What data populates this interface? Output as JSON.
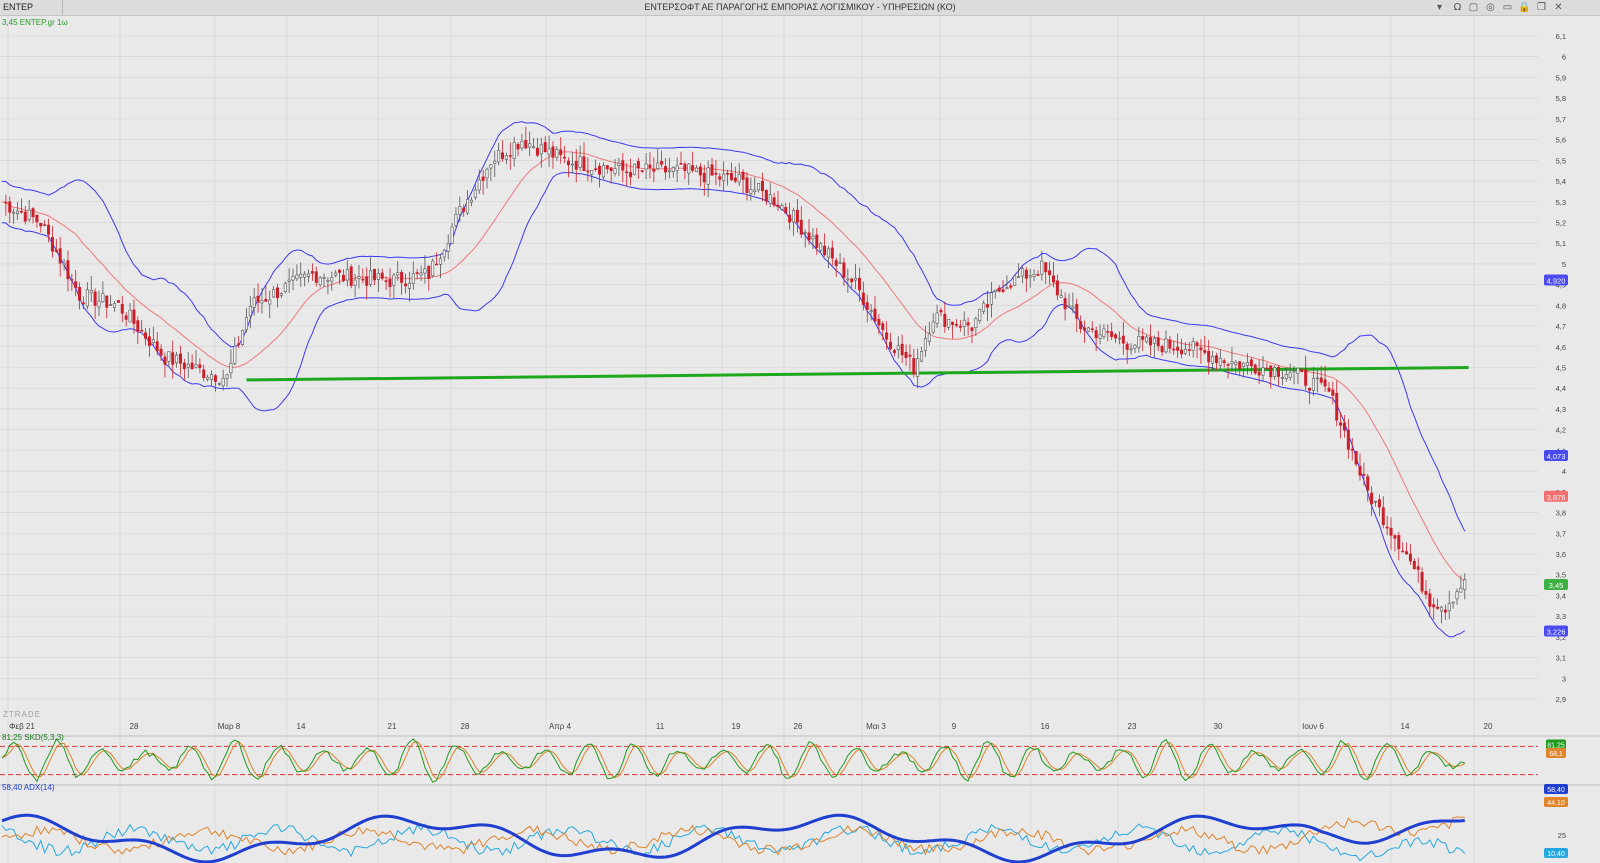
{
  "window": {
    "symbol_tab": "ENTEP",
    "title": "ΕΝΤΕΡΣΟΦΤ ΑΕ ΠΑΡΑΓΩΓΗΣ ΕΜΠΟΡΙΑΣ ΛΟΓΙΣΜΙΚΟΥ - ΥΠΗΡΕΣΙΩΝ  (ΚΟ)",
    "icons": [
      "dropdown-icon",
      "omega-icon",
      "window-icon",
      "layout-icon",
      "minimize-icon",
      "lock-icon",
      "restore-icon",
      "close-icon"
    ]
  },
  "colors": {
    "up_candle": "#555555",
    "down_candle": "#cc1f2a",
    "bollinger": "#3a3af0",
    "ma": "#f07878",
    "support": "#1ea81e",
    "stoch_k": "#1f9a1f",
    "stoch_d": "#e0832a",
    "adx": "#1f3fd0",
    "di_plus": "#26a9e0",
    "di_minus": "#e0832a",
    "grid": "#d2d2d2"
  },
  "chart_data": [
    {
      "type": "candlestick",
      "legend": "3,45 ENTEP.gr 1ω",
      "watermark": "ZTRADE",
      "y_ticks": [
        "6,1",
        "6",
        "5,9",
        "5,8",
        "5,7",
        "5,6",
        "5,5",
        "5,4",
        "5,3",
        "5,2",
        "5,1",
        "5",
        "4,9",
        "4,8",
        "4,7",
        "4,6",
        "4,5",
        "4,4",
        "4,3",
        "4,2",
        "4,1",
        "4",
        "3,9",
        "3,8",
        "3,7",
        "3,6",
        "3,5",
        "3,4",
        "3,3",
        "3,2",
        "3,1",
        "3",
        "2,9"
      ],
      "ylim": [
        2.9,
        6.1
      ],
      "x_ticks": [
        "Φεβ 21",
        "28",
        "Μαρ 8",
        "14",
        "21",
        "28",
        "Απρ 4",
        "11",
        "19",
        "26",
        "Μαι 3",
        "9",
        "16",
        "23",
        "30",
        "Ιουν 6",
        "14",
        "20"
      ],
      "close_anchors": [
        [
          0,
          5.3
        ],
        [
          10,
          5.2
        ],
        [
          20,
          4.85
        ],
        [
          30,
          4.8
        ],
        [
          42,
          4.55
        ],
        [
          52,
          4.48
        ],
        [
          58,
          4.45
        ],
        [
          64,
          4.8
        ],
        [
          80,
          4.95
        ],
        [
          100,
          4.92
        ],
        [
          110,
          4.95
        ],
        [
          118,
          5.25
        ],
        [
          126,
          5.5
        ],
        [
          134,
          5.6
        ],
        [
          145,
          5.5
        ],
        [
          160,
          5.45
        ],
        [
          175,
          5.45
        ],
        [
          190,
          5.4
        ],
        [
          200,
          5.3
        ],
        [
          210,
          5.1
        ],
        [
          220,
          4.9
        ],
        [
          228,
          4.65
        ],
        [
          235,
          4.5
        ],
        [
          240,
          4.75
        ],
        [
          250,
          4.7
        ],
        [
          258,
          4.9
        ],
        [
          268,
          4.98
        ],
        [
          278,
          4.7
        ],
        [
          290,
          4.62
        ],
        [
          305,
          4.6
        ],
        [
          318,
          4.52
        ],
        [
          332,
          4.48
        ],
        [
          342,
          4.38
        ],
        [
          352,
          3.9
        ],
        [
          362,
          3.6
        ],
        [
          368,
          3.38
        ],
        [
          372,
          3.35
        ],
        [
          376,
          3.45
        ]
      ],
      "price_labels": [
        {
          "text": "4,920",
          "value": 4.92,
          "color": "#4a4aee"
        },
        {
          "text": "4,073",
          "value": 4.073,
          "color": "#4a4aee"
        },
        {
          "text": "3,876",
          "value": 3.876,
          "color": "#f07070"
        },
        {
          "text": "3,45",
          "value": 3.45,
          "color": "#3cb043"
        },
        {
          "text": "3,226",
          "value": 3.226,
          "color": "#4a4aee"
        }
      ],
      "support_line": {
        "from": [
          63,
          4.44
        ],
        "to": [
          378,
          4.5
        ]
      }
    },
    {
      "type": "line",
      "legend": "81,25 SKD(5,3,3)",
      "levels": [
        80,
        20
      ],
      "value_labels": [
        {
          "text": "81,25",
          "color": "#1f9a1f"
        },
        {
          "text": "68,1",
          "color": "#e0832a"
        }
      ]
    },
    {
      "type": "line",
      "legend": "58,40 ADX(14)",
      "y_ticks": [
        "25"
      ],
      "value_labels": [
        {
          "text": "58,40",
          "color": "#1f3fd0"
        },
        {
          "text": "44,10",
          "color": "#e0832a"
        },
        {
          "text": "10,40",
          "color": "#26a9e0"
        }
      ]
    }
  ]
}
